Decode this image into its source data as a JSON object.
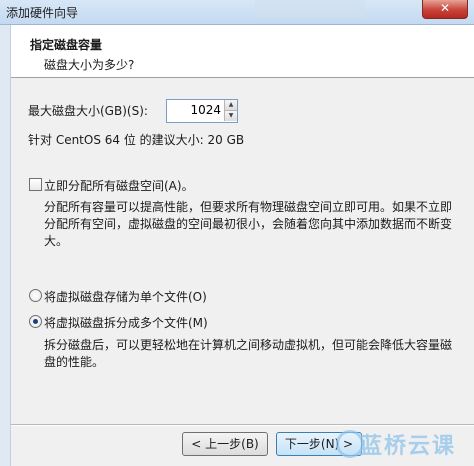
{
  "window": {
    "title": "添加硬件向导",
    "close_label": "✕"
  },
  "header": {
    "title": "指定磁盘容量",
    "subtitle": "磁盘大小为多少?"
  },
  "disk": {
    "max_size_label": "最大磁盘大小(GB)(S):",
    "max_size_value": "1024",
    "recommend_text": "针对 CentOS 64 位 的建议大小: 20 GB"
  },
  "allocate": {
    "checked": false,
    "label": "立即分配所有磁盘空间(A)。",
    "description": "分配所有容量可以提高性能，但要求所有物理磁盘空间立即可用。如果不立即分配所有空间，虚拟磁盘的空间最初很小，会随着您向其中添加数据而不断变大。"
  },
  "storage": {
    "single_label": "将虚拟磁盘存储为单个文件(O)",
    "multi_label": "将虚拟磁盘拆分成多个文件(M)",
    "selected": "multi",
    "multi_description": "拆分磁盘后，可以更轻松地在计算机之间移动虚拟机，但可能会降低大容量磁盘的性能。"
  },
  "footer": {
    "back_label": "< 上一步(B)",
    "next_label": "下一步(N) >",
    "watermark_text": "蓝桥云课"
  }
}
